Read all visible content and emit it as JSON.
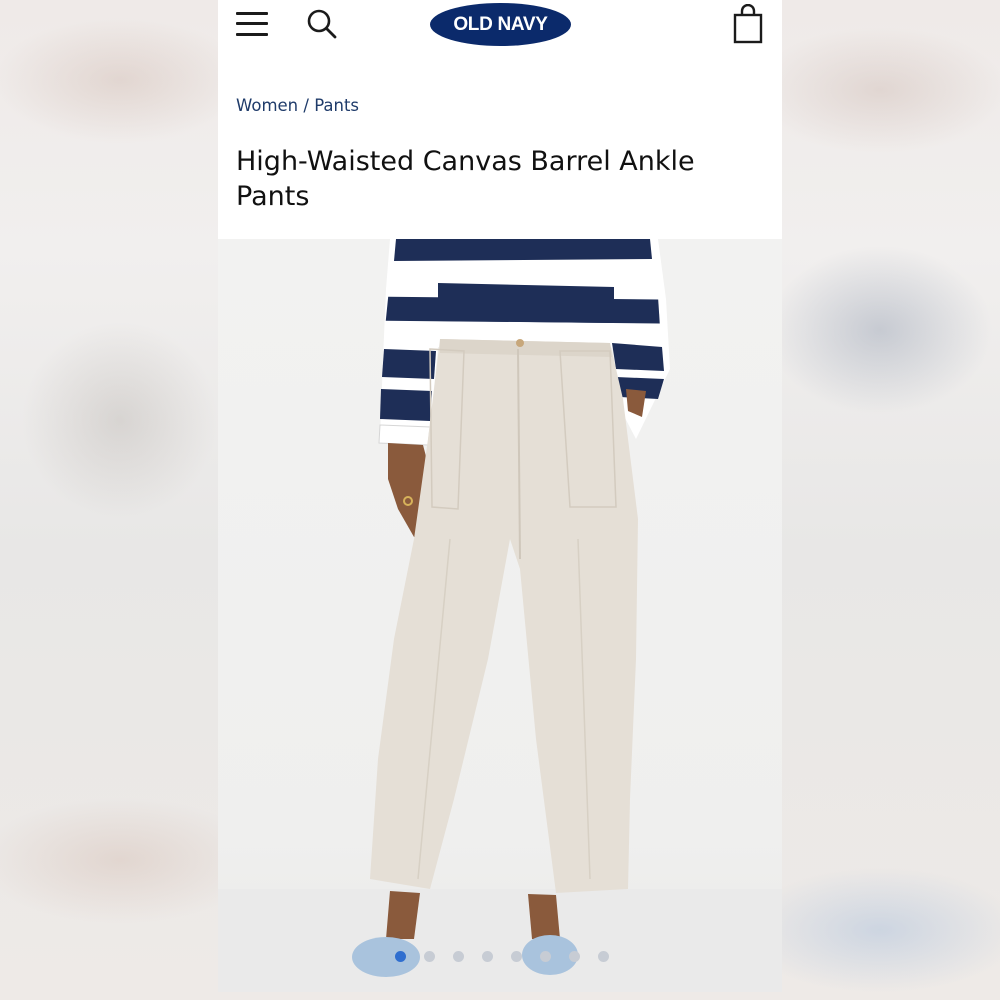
{
  "header": {
    "menu_icon": "hamburger-menu-icon",
    "search_icon": "search-icon",
    "logo_text": "OLD NAVY",
    "bag_icon": "shopping-bag-icon",
    "brand_color": "#0b2a6b"
  },
  "breadcrumb": {
    "items": [
      "Women",
      "Pants"
    ],
    "separator": "/"
  },
  "product": {
    "title": "High-Waisted Canvas Barrel Ankle Pants",
    "image_alt": "Model wearing cream barrel ankle pants with a navy and white striped top"
  },
  "carousel": {
    "total_images": 8,
    "active_index": 0,
    "active_color": "#2f6ecf",
    "inactive_color": "#c7ccd4"
  }
}
